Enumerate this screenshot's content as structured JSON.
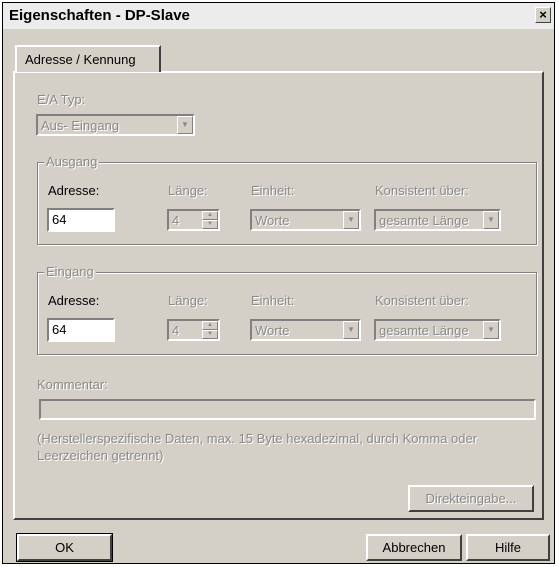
{
  "window": {
    "title": "Eigenschaften - DP-Slave",
    "close_glyph": "×"
  },
  "tabs": [
    {
      "label": "Adresse / Kennung",
      "active": true
    }
  ],
  "ea_typ": {
    "label": "E/A Typ:",
    "value": "Aus- Eingang"
  },
  "ausgang": {
    "legend": "Ausgang",
    "adresse_label": "Adresse:",
    "adresse_value": "64",
    "laenge_label": "Länge:",
    "laenge_value": "4",
    "einheit_label": "Einheit:",
    "einheit_value": "Worte",
    "konsistent_label": "Konsistent über:",
    "konsistent_value": "gesamte Länge"
  },
  "eingang": {
    "legend": "Eingang",
    "adresse_label": "Adresse:",
    "adresse_value": "64",
    "laenge_label": "Länge:",
    "laenge_value": "4",
    "einheit_label": "Einheit:",
    "einheit_value": "Worte",
    "konsistent_label": "Konsistent über:",
    "konsistent_value": "gesamte Länge"
  },
  "kommentar": {
    "label": "Kommentar:",
    "hint": "(Herstellerspezifische Daten, max. 15 Byte hexadezimal, durch Komma oder Leerzeichen getrennt)"
  },
  "buttons": {
    "direkteingabe": "Direkteingabe...",
    "ok": "OK",
    "abbrechen": "Abbrechen",
    "hilfe": "Hilfe"
  },
  "icons": {
    "dropdown": "chevron-down-icon",
    "spin": "spin-arrows-icon",
    "close": "close-icon"
  },
  "colors": {
    "dialog_bg": "#d4d0c8",
    "disabled_text": "#8a8a8a",
    "titlebar_bg": "#ececec"
  }
}
